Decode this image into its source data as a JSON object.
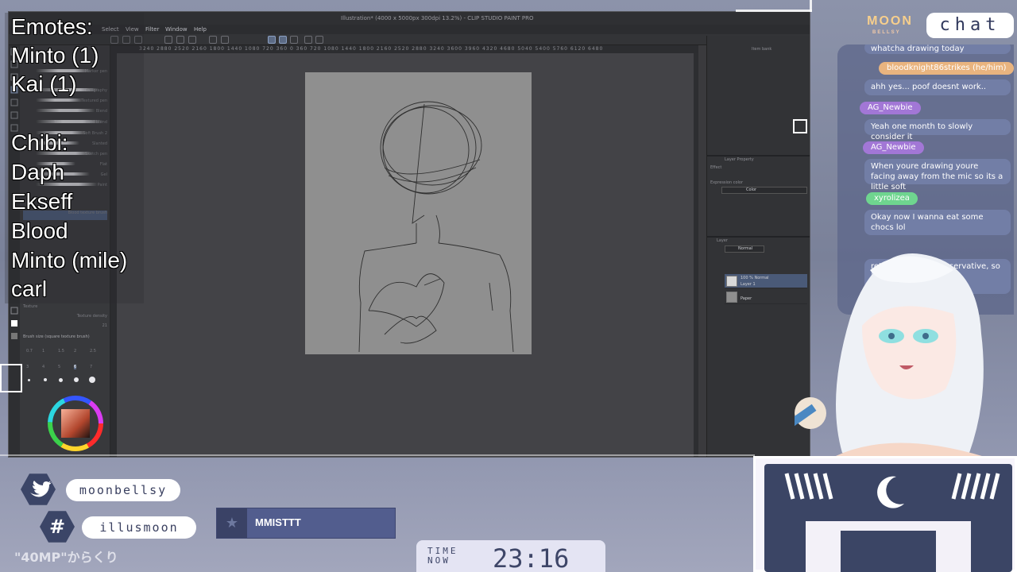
{
  "app": {
    "title": "Illustration* (4000 x 5000px 300dpi 13.2%) - CLIP STUDIO PAINT PRO",
    "menu": [
      "Select",
      "View",
      "Filter",
      "Window",
      "Help"
    ],
    "ruler_text": "3240 2880 2520 2160 1800 1440 1080 720 360 0 360 720 1080 1440 1800 2160 2520 2880 3240 3600 3960 4320 4680 5040 5400 5760 6120 6480",
    "brushes": [
      "Marker pen",
      "Calligraphy",
      "Textured pen",
      "Blend",
      "Tone line - block and blend",
      "Soft Brush 2",
      "Slanted",
      "Sketch pen",
      "Flat",
      "Gel",
      "Paint",
      "Blood texture brush",
      "Texture density"
    ],
    "brush_size_label": "Brush size (square texture brush)",
    "brush_sizes_row1": [
      "0.7",
      "1",
      "1.5",
      "2",
      "2.5"
    ],
    "brush_sizes_row2": [
      "3",
      "4",
      "5",
      "6",
      "7"
    ],
    "texture_label": "Texture",
    "texture_value": "100",
    "density_value": "21",
    "right_panel": {
      "item_bank_tab": "Item bank",
      "layer_property_tab": "Layer Property",
      "effect_label": "Effect",
      "expression_color_label": "Expression color",
      "expression_color_value": "Color",
      "layer_tab": "Layer",
      "blend_mode": "Normal",
      "layers": [
        {
          "name": "100 % Normal",
          "sub": "Layer 1"
        },
        {
          "name": "Paper",
          "sub": ""
        }
      ]
    }
  },
  "emotes": {
    "lines": [
      "Emotes:",
      "Minto (1)",
      "Kai (1)",
      "",
      "Chibi:",
      "Daph",
      "Ekseff",
      "Blood",
      "Minto (mile)",
      "carl"
    ]
  },
  "chat": {
    "logo": "MOON",
    "logo_sub": "BELLSY",
    "label": "chat",
    "messages": [
      {
        "user": "",
        "text": "whatcha drawing today",
        "color": ""
      },
      {
        "user": "bloodknight86strikes (he/him)",
        "text": "ahh yes... poof doesnt work..",
        "color": "#e9b47f"
      },
      {
        "user": "AG_Newbie",
        "text": "Yeah one month to slowly consider it",
        "color": "#a277d6"
      },
      {
        "user": "AG_Newbie",
        "text": "When youre drawing youre facing away from the mic so its a little soft",
        "color": "#a277d6"
      },
      {
        "user": "xyrolizea",
        "text": "Okay now I wanna eat some chocs lol",
        "color": "#6fd58f"
      },
      {
        "user": "",
        "text": "re's psychology conservative, so itate in a sense.",
        "color": "#e88a7a"
      }
    ]
  },
  "socials": [
    {
      "icon": "twitter-icon",
      "handle": "moonbellsy"
    },
    {
      "icon": "hashtag-icon",
      "handle": "illusmoon"
    }
  ],
  "follower": {
    "name": "MMISTTT"
  },
  "clock": {
    "label_top": "TIME",
    "label_bottom": "NOW",
    "time": "23:16"
  },
  "ticker": "\"40MP\"からくり",
  "colors": {
    "accent": "#3b4567",
    "chat_bubble": "#737fa8",
    "follower_bar": "#525d8e",
    "clock_bg": "#e4e4f3"
  }
}
